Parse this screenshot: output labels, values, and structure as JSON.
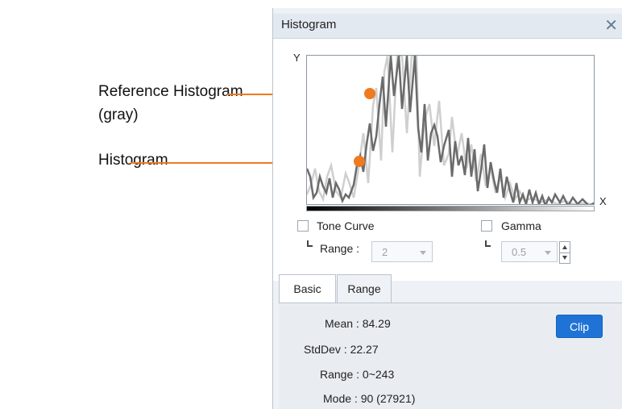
{
  "annotations": {
    "reference_line1": "Reference Histogram",
    "reference_line2": "(gray)",
    "histogram": "Histogram",
    "line_color": "#f07a1e"
  },
  "window": {
    "title": "Histogram",
    "close_icon": "close-icon"
  },
  "plot": {
    "y_label": "Y",
    "x_label": "X",
    "histogram_color": "#6b6b6b",
    "reference_color": "#cfcfcf"
  },
  "controls": {
    "tone_curve": {
      "label": "Tone Curve",
      "checked": false
    },
    "tone_range": {
      "label": "Range :",
      "value": "2"
    },
    "gamma": {
      "label": "Gamma",
      "checked": false
    },
    "gamma_value": {
      "value": "0.5"
    }
  },
  "tabs": [
    {
      "label": "Basic",
      "active": true
    },
    {
      "label": "Range",
      "active": false
    }
  ],
  "stats": {
    "mean": "Mean : 84.29",
    "stddev": "StdDev : 22.27",
    "range": "Range : 0~243",
    "mode": "Mode : 90 (27921)"
  },
  "clip_button": {
    "label": "Clip",
    "color": "#1f73d6"
  }
}
